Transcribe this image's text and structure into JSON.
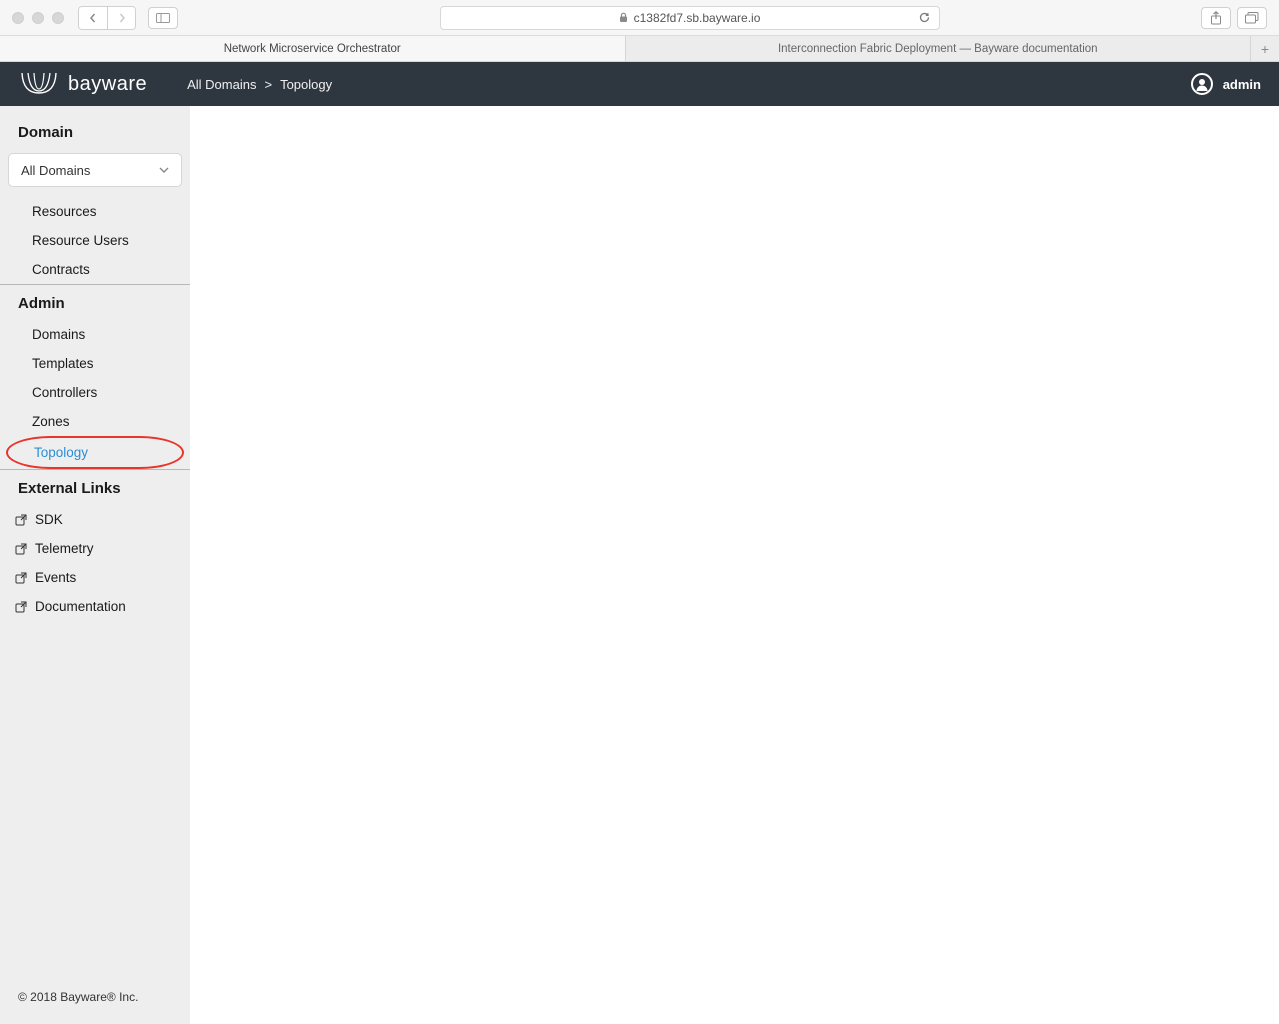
{
  "browser": {
    "url": "c1382fd7.sb.bayware.io",
    "tabs": [
      {
        "title": "Network Microservice Orchestrator",
        "active": true
      },
      {
        "title": "Interconnection Fabric Deployment — Bayware documentation",
        "active": false
      }
    ]
  },
  "header": {
    "logo_text": "bayware",
    "breadcrumb": {
      "root": "All Domains",
      "sep": ">",
      "current": "Topology"
    },
    "user": "admin"
  },
  "sidebar": {
    "domain": {
      "title": "Domain",
      "select_value": "All Domains",
      "items": [
        {
          "label": "Resources"
        },
        {
          "label": "Resource Users"
        },
        {
          "label": "Contracts"
        }
      ]
    },
    "admin": {
      "title": "Admin",
      "items": [
        {
          "label": "Domains"
        },
        {
          "label": "Templates"
        },
        {
          "label": "Controllers"
        },
        {
          "label": "Zones"
        },
        {
          "label": "Topology",
          "active": true,
          "highlighted": true
        }
      ]
    },
    "external": {
      "title": "External Links",
      "items": [
        {
          "label": "SDK"
        },
        {
          "label": "Telemetry"
        },
        {
          "label": "Events"
        },
        {
          "label": "Documentation"
        }
      ]
    },
    "footer": "© 2018 Bayware® Inc."
  }
}
